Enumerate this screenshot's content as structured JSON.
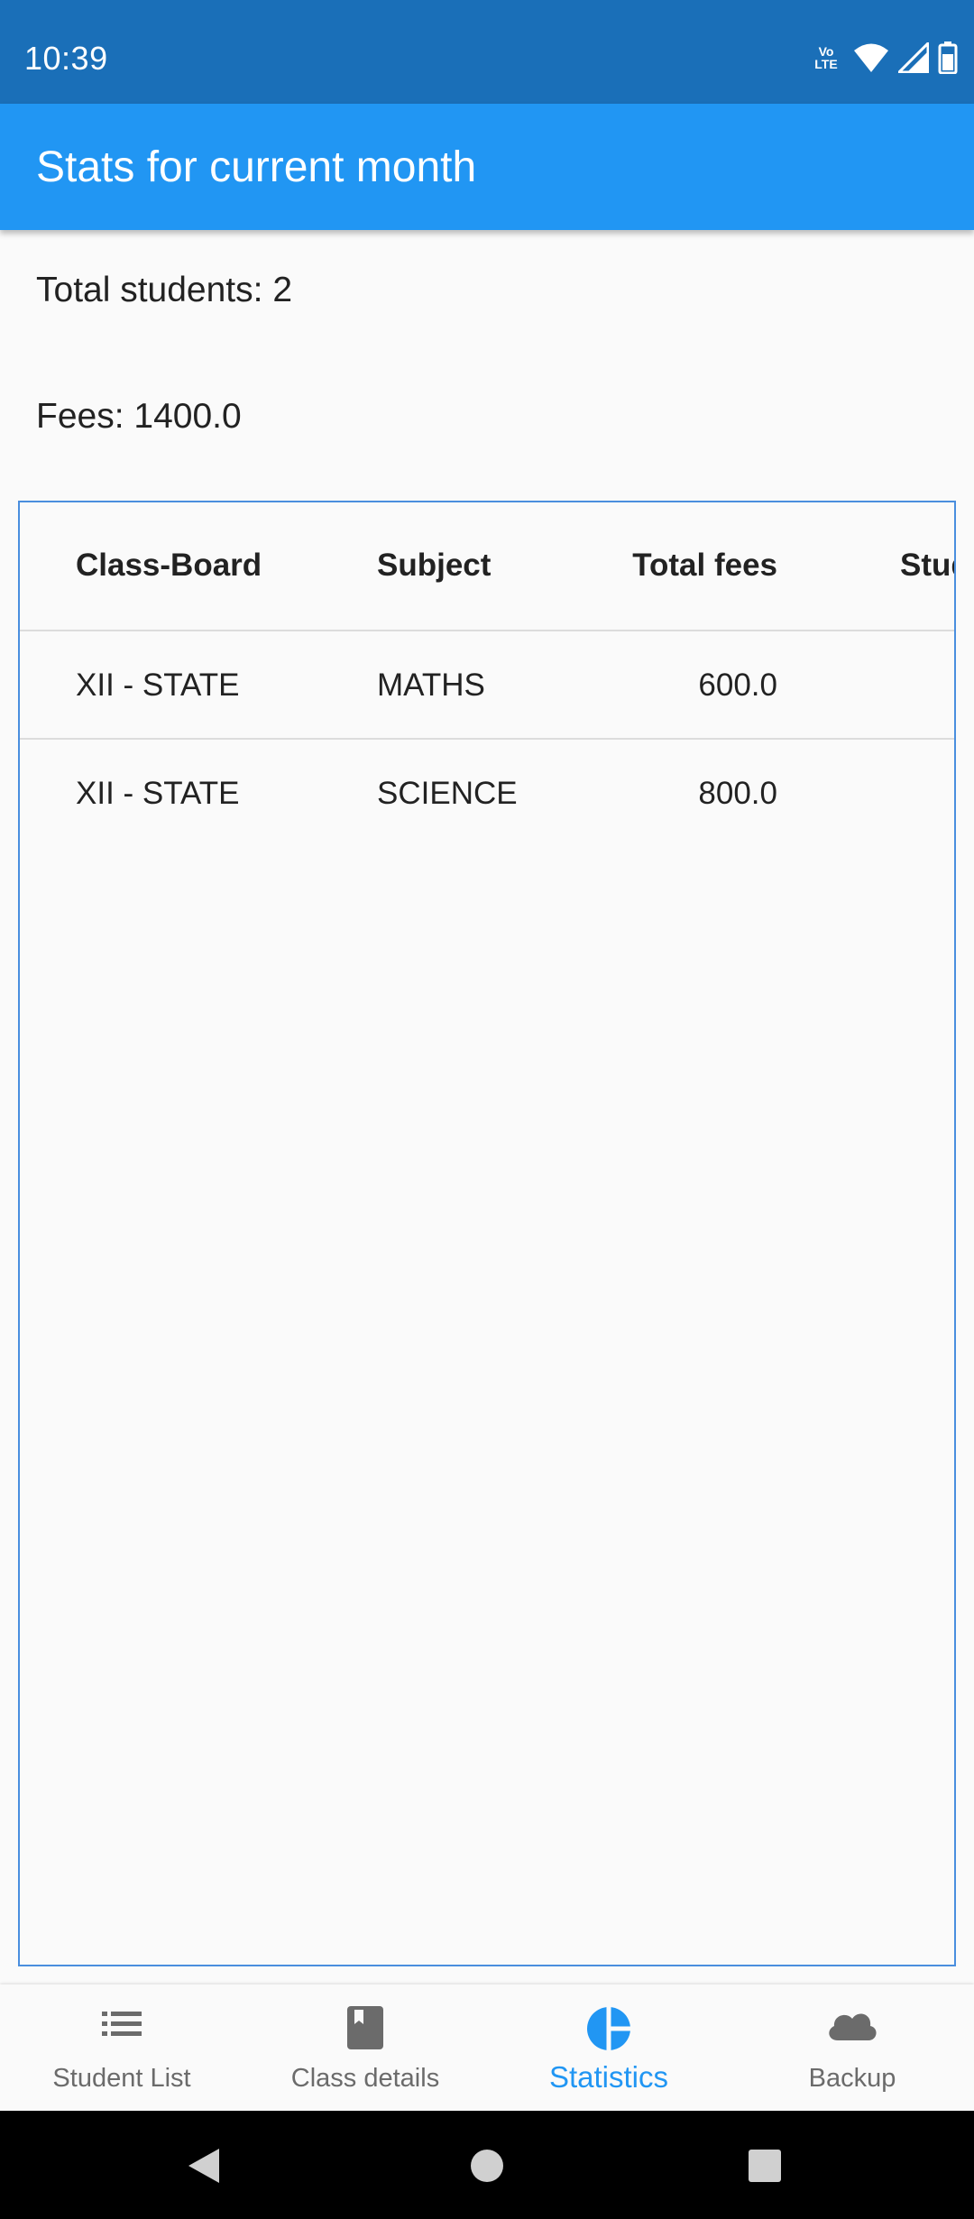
{
  "status_bar": {
    "time": "10:39",
    "volte_top": "Vo",
    "volte_bottom": "LTE",
    "icons": [
      "volte-icon",
      "wifi-icon",
      "signal-icon",
      "battery-icon"
    ]
  },
  "app_bar": {
    "title": "Stats for current month"
  },
  "summary": {
    "students": "Total students: 2",
    "fees": "Fees: 1400.0"
  },
  "table": {
    "columns": [
      "Class-Board",
      "Subject",
      "Total fees",
      "Stud"
    ],
    "rows": [
      [
        "XII - STATE",
        "MATHS",
        "600.0"
      ],
      [
        "XII - STATE",
        "SCIENCE",
        "800.0"
      ]
    ]
  },
  "bottom_nav": {
    "items": [
      {
        "label": "Student List",
        "icon": "list-icon"
      },
      {
        "label": "Class details",
        "icon": "book-icon"
      },
      {
        "label": "Statistics",
        "icon": "pie-chart-icon",
        "active": true
      },
      {
        "label": "Backup",
        "icon": "cloud-icon"
      }
    ]
  },
  "colors": {
    "status_bar": "#1a6fb8",
    "app_bar": "#2196f3",
    "accent": "#2196f3",
    "table_border": "#4a8ede",
    "inactive": "#6b6b6b"
  }
}
